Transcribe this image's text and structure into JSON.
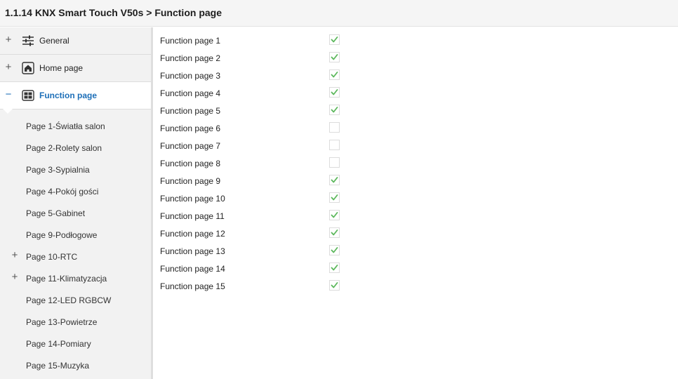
{
  "header": {
    "title": "1.1.14 KNX Smart Touch V50s > Function page"
  },
  "sidebar": {
    "items": [
      {
        "label": "General",
        "toggle": "+",
        "icon": "sliders-icon"
      },
      {
        "label": "Home page",
        "toggle": "+",
        "icon": "home-icon"
      },
      {
        "label": "Function page",
        "toggle": "−",
        "icon": "grid-icon",
        "active": true
      }
    ],
    "subitems": [
      {
        "label": "Page 1-Światła salon",
        "toggle": ""
      },
      {
        "label": "Page 2-Rolety salon",
        "toggle": ""
      },
      {
        "label": "Page 3-Sypialnia",
        "toggle": ""
      },
      {
        "label": "Page 4-Pokój gości",
        "toggle": ""
      },
      {
        "label": "Page 5-Gabinet",
        "toggle": ""
      },
      {
        "label": "Page 9-Podłogowe",
        "toggle": ""
      },
      {
        "label": "Page 10-RTC",
        "toggle": "+"
      },
      {
        "label": "Page 11-Klimatyzacja",
        "toggle": "+"
      },
      {
        "label": "Page 12-LED RGBCW",
        "toggle": ""
      },
      {
        "label": "Page 13-Powietrze",
        "toggle": ""
      },
      {
        "label": "Page 14-Pomiary",
        "toggle": ""
      },
      {
        "label": "Page 15-Muzyka",
        "toggle": ""
      }
    ]
  },
  "main": {
    "rows": [
      {
        "label": "Function page 1",
        "checked": true
      },
      {
        "label": "Function page 2",
        "checked": true
      },
      {
        "label": "Function page 3",
        "checked": true
      },
      {
        "label": "Function page 4",
        "checked": true
      },
      {
        "label": "Function page 5",
        "checked": true
      },
      {
        "label": "Function page 6",
        "checked": false
      },
      {
        "label": "Function page 7",
        "checked": false
      },
      {
        "label": "Function page 8",
        "checked": false
      },
      {
        "label": "Function page 9",
        "checked": true
      },
      {
        "label": "Function page 10",
        "checked": true
      },
      {
        "label": "Function page 11",
        "checked": true
      },
      {
        "label": "Function page 12",
        "checked": true
      },
      {
        "label": "Function page 13",
        "checked": true
      },
      {
        "label": "Function page 14",
        "checked": true
      },
      {
        "label": "Function page 15",
        "checked": true
      }
    ]
  },
  "colors": {
    "accent": "#1d6fb8",
    "check": "#5cb85c"
  }
}
